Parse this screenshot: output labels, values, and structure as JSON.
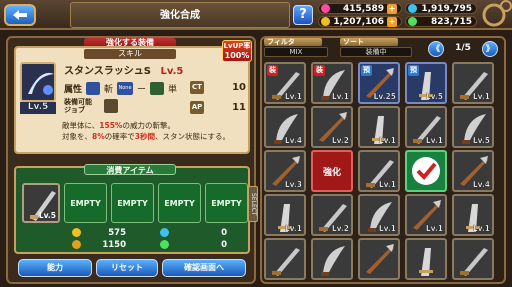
{
  "header": {
    "title": "強化合成",
    "help_label": "?",
    "resources": {
      "hearts": "415,589",
      "coins": "1,207,106",
      "gems_a": "1,919,795",
      "gems_b": "823,715"
    },
    "colors": {
      "hearts": "#ff4aa0",
      "coins": "#f0c020",
      "gems_a": "#40c0f0",
      "gems_b": "#50e060"
    }
  },
  "equip_section": {
    "label": "強化する装備",
    "sub_label": "スキル",
    "lvup_label": "LvUP率",
    "lvup_value": "100%",
    "weapon_level": "Lv.5",
    "item_name": "スタンスラッシュS",
    "item_level": "Lv.5",
    "attribute_label": "属性",
    "attr_element": "斬",
    "attr_none": "None",
    "attr_dash": "ー",
    "attr_single": "単",
    "ct_label": "CT",
    "ct_value": "10",
    "ap_label": "AP",
    "ap_value": "11",
    "job_label": "装備可能\nジョブ",
    "desc_prefix": "敵単体に、",
    "desc_pct": "155%",
    "desc_mid": "の威力の斬撃。",
    "desc_line2_prefix": "対象を、",
    "desc_chance": "8%",
    "desc_mid2": "の確率で",
    "desc_turns": "3秒間",
    "desc_suffix": "、スタン状態にする。"
  },
  "consume_section": {
    "label": "消費アイテム",
    "item_level": "Lv.5",
    "empty_slots": [
      "EMPTY",
      "EMPTY",
      "EMPTY",
      "EMPTY"
    ],
    "cost_coin": "575",
    "cost_coin_extra": "0",
    "cost_gold": "1150",
    "cost_gold_extra": "0"
  },
  "buttons": {
    "ability": "能力",
    "reset": "リセット",
    "confirm": "確認画面へ",
    "side_tab": "SELECT"
  },
  "filter": {
    "filter_label": "フィルタ",
    "filter_value": "MIX",
    "sort_label": "ソート",
    "sort_value": "装備中",
    "page": "1/5",
    "prev": "《",
    "next": "》"
  },
  "grid_items": [
    {
      "level": "Lv.1",
      "badge": "装",
      "style": "normal"
    },
    {
      "level": "Lv.1",
      "badge": "装",
      "style": "normal"
    },
    {
      "level": "Lv.25",
      "badge": "預",
      "style": "blue"
    },
    {
      "level": "Lv.5",
      "badge": "預",
      "style": "blue"
    },
    {
      "level": "Lv.1",
      "badge": "",
      "style": "normal"
    },
    {
      "level": "Lv.4",
      "badge": "",
      "style": "normal"
    },
    {
      "level": "Lv.2",
      "badge": "",
      "style": "normal"
    },
    {
      "level": "Lv.1",
      "badge": "",
      "style": "normal"
    },
    {
      "level": "Lv.1",
      "badge": "",
      "style": "normal"
    },
    {
      "level": "Lv.5",
      "badge": "",
      "style": "normal"
    },
    {
      "level": "Lv.3",
      "badge": "",
      "style": "normal"
    },
    {
      "level": "",
      "badge": "",
      "style": "red",
      "label": "強化"
    },
    {
      "level": "Lv.1",
      "badge": "",
      "style": "normal"
    },
    {
      "level": "",
      "badge": "",
      "style": "sel"
    },
    {
      "level": "Lv.4",
      "badge": "",
      "style": "normal"
    },
    {
      "level": "Lv.1",
      "badge": "",
      "style": "normal"
    },
    {
      "level": "Lv.2",
      "badge": "",
      "style": "normal"
    },
    {
      "level": "Lv.1",
      "badge": "",
      "style": "normal"
    },
    {
      "level": "Lv.1",
      "badge": "",
      "style": "normal"
    },
    {
      "level": "Lv.1",
      "badge": "",
      "style": "normal"
    },
    {
      "level": "",
      "badge": "",
      "style": "normal"
    },
    {
      "level": "",
      "badge": "",
      "style": "normal"
    },
    {
      "level": "",
      "badge": "",
      "style": "normal"
    },
    {
      "level": "",
      "badge": "",
      "style": "normal"
    },
    {
      "level": "",
      "badge": "",
      "style": "normal"
    }
  ]
}
